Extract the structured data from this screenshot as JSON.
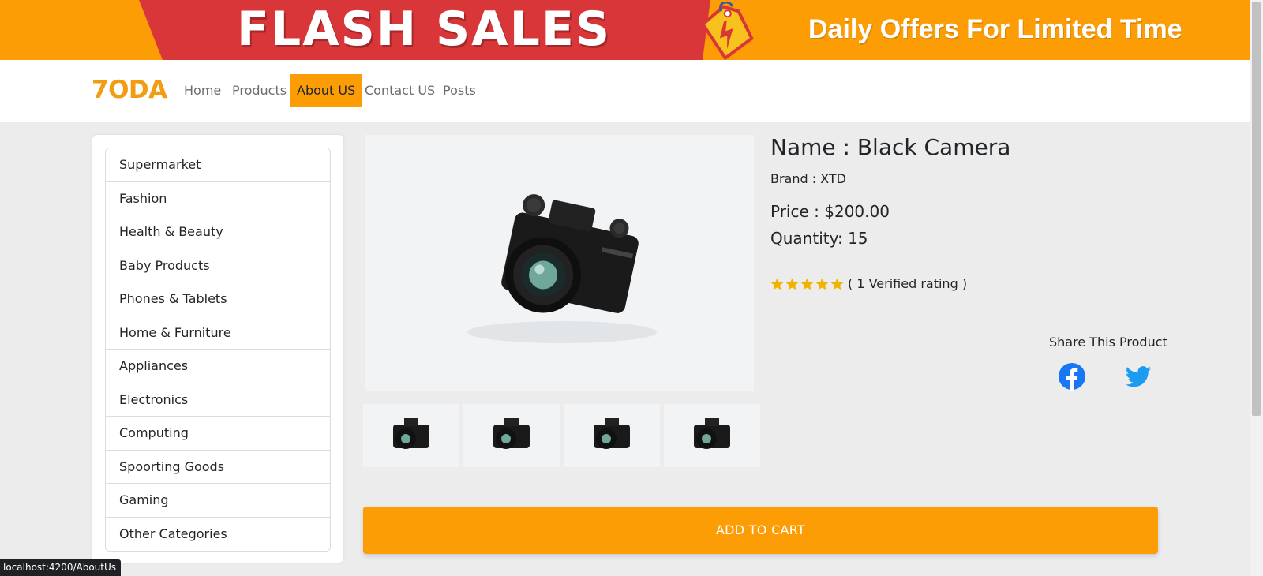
{
  "banner": {
    "flash_text": "FLASH SALES",
    "daily_text": "Daily Offers For Limited Time",
    "tag_icon": "sale-tag-lightning-icon"
  },
  "navbar": {
    "brand": "7ODA",
    "links": [
      {
        "label": "Home"
      },
      {
        "label": "Products"
      },
      {
        "label": "About US",
        "active": true
      },
      {
        "label": "Contact US"
      },
      {
        "label": "Posts"
      }
    ]
  },
  "sidebar": {
    "categories": [
      "Supermarket",
      "Fashion",
      "Health & Beauty",
      "Baby Products",
      "Phones & Tablets",
      "Home & Furniture",
      "Appliances",
      "Electronics",
      "Computing",
      "Spoorting Goods",
      "Gaming",
      "Other Categories"
    ]
  },
  "product": {
    "name": "Name : Black Camera",
    "brand": "Brand : XTD",
    "price": "Price : $200.00",
    "quantity": "Quantity: 15",
    "rating_stars": 5,
    "rating_text": "( 1 Verified rating )",
    "main_image_icon": "camera-icon",
    "thumbnails": 4
  },
  "share": {
    "title": "Share This Product",
    "facebook_icon": "facebook-icon",
    "twitter_icon": "twitter-icon"
  },
  "cart": {
    "button_label": "ADD TO CART"
  },
  "status_bar": {
    "url": "localhost:4200/AboutUs"
  },
  "colors": {
    "accent": "#fd9d06",
    "banner_red": "#d9363a",
    "brand_text": "#f29c12",
    "star": "#f0b400",
    "facebook": "#1877f2",
    "twitter": "#1d9bf0"
  }
}
